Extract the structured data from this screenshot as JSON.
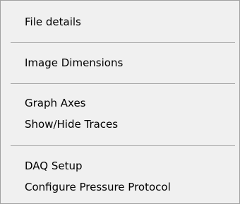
{
  "menu": {
    "items": [
      {
        "label": "File details"
      },
      {
        "label": "Image Dimensions"
      },
      {
        "label": "Graph Axes"
      },
      {
        "label": "Show/Hide Traces"
      },
      {
        "label": "DAQ Setup"
      },
      {
        "label": "Configure Pressure Protocol"
      }
    ]
  }
}
